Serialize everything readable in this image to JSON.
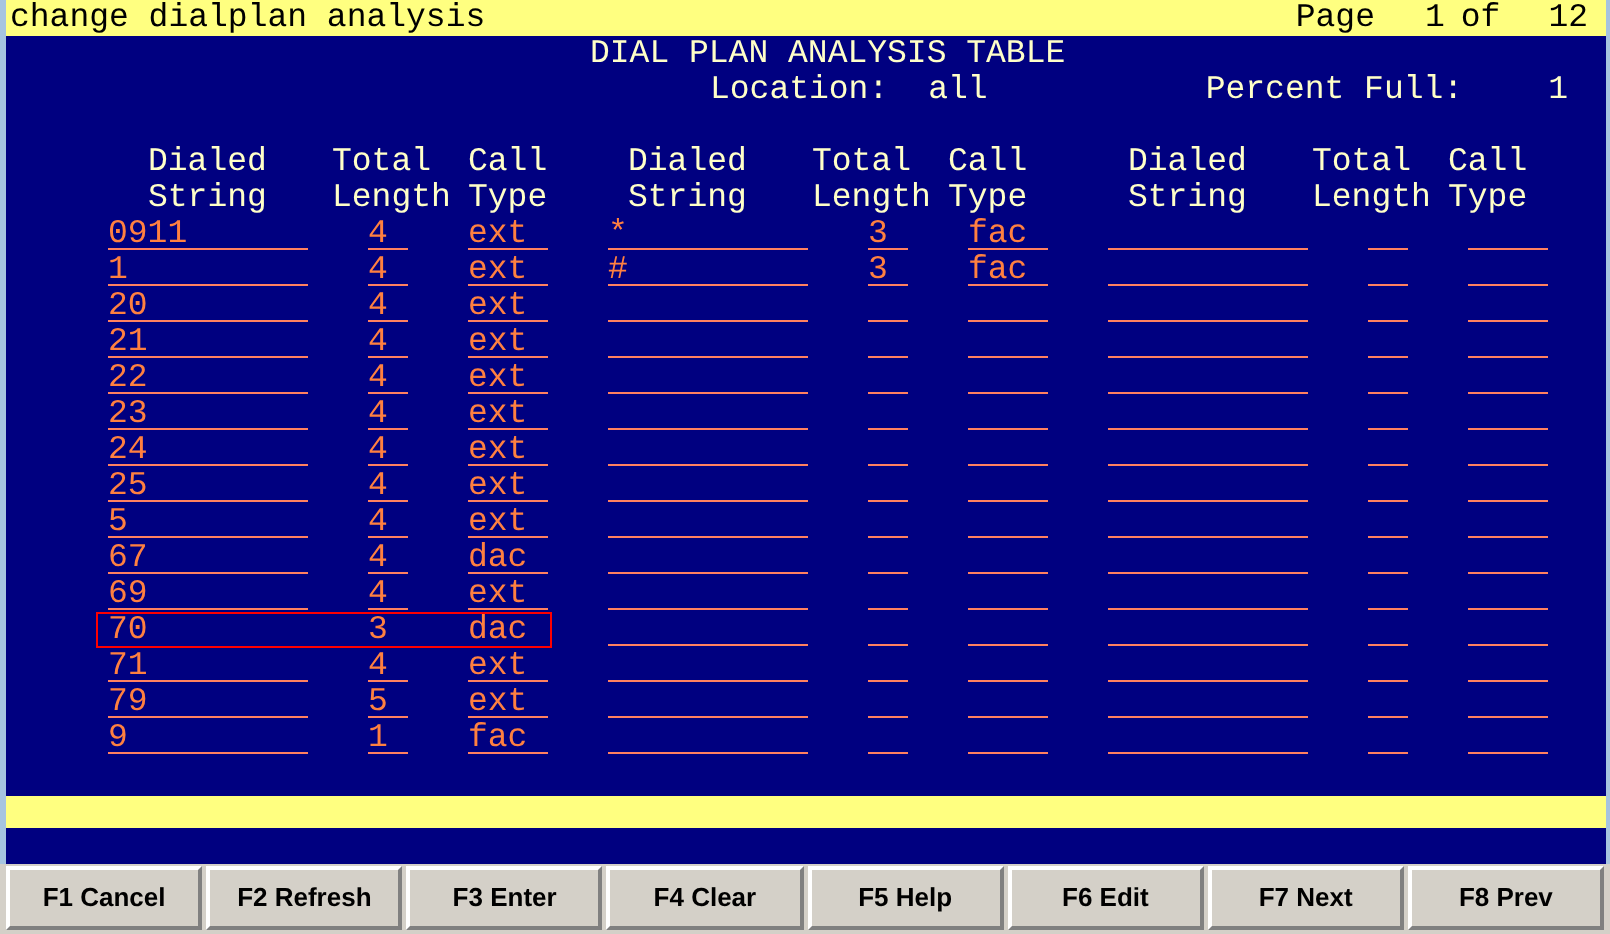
{
  "title_bar": {
    "command": "change dialplan analysis",
    "page_label": "Page",
    "page": "1",
    "of_label": "of",
    "page_count": "12"
  },
  "heading": "DIAL PLAN ANALYSIS TABLE",
  "location_label": "Location:",
  "location": "all",
  "percent_full_label": "Percent Full:",
  "percent_full": "1",
  "columns": [
    {
      "top": "Dialed",
      "bottom": "String"
    },
    {
      "top": "Total",
      "bottom": "Length"
    },
    {
      "top": "Call",
      "bottom": "Type"
    },
    {
      "top": "Dialed",
      "bottom": "String"
    },
    {
      "top": "Total",
      "bottom": "Length"
    },
    {
      "top": "Call",
      "bottom": "Type"
    },
    {
      "top": "Dialed",
      "bottom": "String"
    },
    {
      "top": "Total",
      "bottom": "Length"
    },
    {
      "top": "Call",
      "bottom": "Type"
    }
  ],
  "rows": [
    {
      "selected": false,
      "entries": [
        {
          "dialed_string": "0911",
          "total_length": "4",
          "call_type": "ext"
        },
        {
          "dialed_string": "*",
          "total_length": "3",
          "call_type": "fac"
        }
      ]
    },
    {
      "selected": false,
      "entries": [
        {
          "dialed_string": "1",
          "total_length": "4",
          "call_type": "ext"
        },
        {
          "dialed_string": "#",
          "total_length": "3",
          "call_type": "fac"
        }
      ]
    },
    {
      "selected": false,
      "entries": [
        {
          "dialed_string": "20",
          "total_length": "4",
          "call_type": "ext"
        }
      ]
    },
    {
      "selected": false,
      "entries": [
        {
          "dialed_string": "21",
          "total_length": "4",
          "call_type": "ext"
        }
      ]
    },
    {
      "selected": false,
      "entries": [
        {
          "dialed_string": "22",
          "total_length": "4",
          "call_type": "ext"
        }
      ]
    },
    {
      "selected": false,
      "entries": [
        {
          "dialed_string": "23",
          "total_length": "4",
          "call_type": "ext"
        }
      ]
    },
    {
      "selected": false,
      "entries": [
        {
          "dialed_string": "24",
          "total_length": "4",
          "call_type": "ext"
        }
      ]
    },
    {
      "selected": false,
      "entries": [
        {
          "dialed_string": "25",
          "total_length": "4",
          "call_type": "ext"
        }
      ]
    },
    {
      "selected": false,
      "entries": [
        {
          "dialed_string": "5",
          "total_length": "4",
          "call_type": "ext"
        }
      ]
    },
    {
      "selected": false,
      "entries": [
        {
          "dialed_string": "67",
          "total_length": "4",
          "call_type": "dac"
        }
      ]
    },
    {
      "selected": false,
      "entries": [
        {
          "dialed_string": "69",
          "total_length": "4",
          "call_type": "ext"
        }
      ]
    },
    {
      "selected": true,
      "entries": [
        {
          "dialed_string": "70",
          "total_length": "3",
          "call_type": "dac"
        }
      ]
    },
    {
      "selected": false,
      "entries": [
        {
          "dialed_string": "71",
          "total_length": "4",
          "call_type": "ext"
        }
      ]
    },
    {
      "selected": false,
      "entries": [
        {
          "dialed_string": "79",
          "total_length": "5",
          "call_type": "ext"
        }
      ]
    },
    {
      "selected": false,
      "entries": [
        {
          "dialed_string": "9",
          "total_length": "1",
          "call_type": "fac"
        }
      ]
    }
  ],
  "function_keys": [
    "F1 Cancel",
    "F2 Refresh",
    "F3 Enter",
    "F4 Clear",
    "F5 Help",
    "F6 Edit",
    "F7 Next",
    "F8 Prev"
  ]
}
